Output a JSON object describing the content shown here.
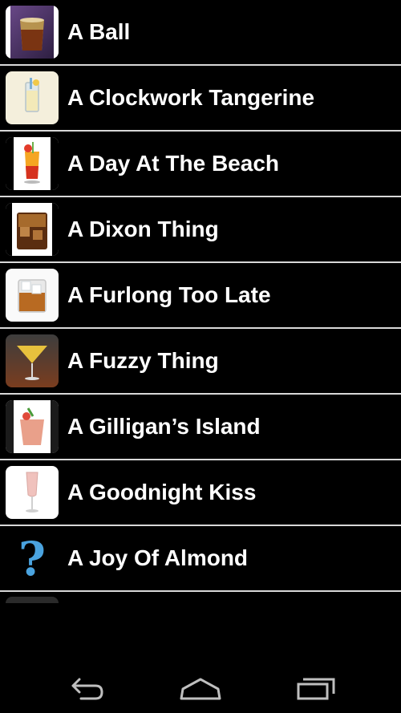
{
  "drinks": [
    {
      "name": "A Ball",
      "icon": "whiskey-glass-icon"
    },
    {
      "name": "A Clockwork Tangerine",
      "icon": "highball-glass-icon"
    },
    {
      "name": "A Day At The Beach",
      "icon": "tropical-cocktail-icon"
    },
    {
      "name": "A Dixon Thing",
      "icon": "rocks-glass-icon"
    },
    {
      "name": "A Furlong Too Late",
      "icon": "ice-whiskey-glass-icon"
    },
    {
      "name": "A Fuzzy Thing",
      "icon": "martini-glass-icon"
    },
    {
      "name": "A Gilligan’s Island",
      "icon": "garnished-cocktail-icon"
    },
    {
      "name": "A Goodnight Kiss",
      "icon": "champagne-flute-icon"
    },
    {
      "name": "A Joy Of Almond",
      "icon": "question-mark-icon"
    }
  ],
  "navbar": {
    "back_icon": "back-icon",
    "home_icon": "home-icon",
    "recents_icon": "recent-apps-icon"
  },
  "colors": {
    "background": "#000000",
    "divider": "#d8d8d8",
    "text": "#ffffff",
    "question_mark": "#4aa3df"
  }
}
